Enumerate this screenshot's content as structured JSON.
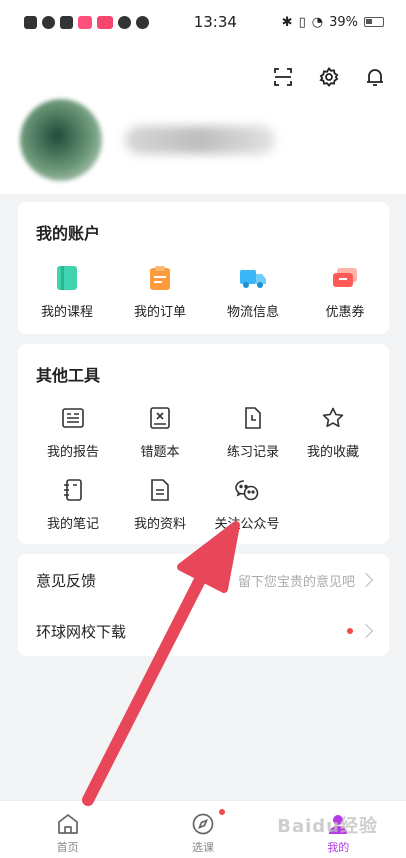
{
  "status_bar": {
    "time": "13:34",
    "battery": "39%"
  },
  "account": {
    "title": "我的账户",
    "items": [
      {
        "label": "我的课程",
        "icon": "course-book-icon",
        "color": "#3fd3b0"
      },
      {
        "label": "我的订单",
        "icon": "order-clipboard-icon",
        "color": "#ff9b3d"
      },
      {
        "label": "物流信息",
        "icon": "delivery-truck-icon",
        "color": "#3ab5f5"
      },
      {
        "label": "优惠券",
        "icon": "coupon-ticket-icon",
        "color": "#ff5a56"
      }
    ]
  },
  "tools": {
    "title": "其他工具",
    "items": [
      {
        "label": "我的报告",
        "icon": "report-icon"
      },
      {
        "label": "错题本",
        "icon": "wrong-questions-book-icon"
      },
      {
        "label": "练习记录",
        "icon": "practice-record-icon"
      },
      {
        "label": "我的收藏",
        "icon": "star-icon"
      },
      {
        "label": "我的笔记",
        "icon": "notebook-icon"
      },
      {
        "label": "我的资料",
        "icon": "document-icon"
      },
      {
        "label": "关注公众号",
        "icon": "wechat-icon"
      }
    ]
  },
  "list": {
    "feedback": {
      "title": "意见反馈",
      "hint": "留下您宝贵的意见吧"
    },
    "download": {
      "title": "环球网校下载"
    }
  },
  "bottom_nav": [
    {
      "label": "首页",
      "icon": "home-icon"
    },
    {
      "label": "选课",
      "icon": "compass-icon"
    },
    {
      "label": "我的",
      "icon": "profile-icon"
    }
  ],
  "watermark": "Baidu经验",
  "colors": {
    "accent": "#b638e6",
    "arrow": "#e8475a",
    "dot": "#f04a4a"
  }
}
